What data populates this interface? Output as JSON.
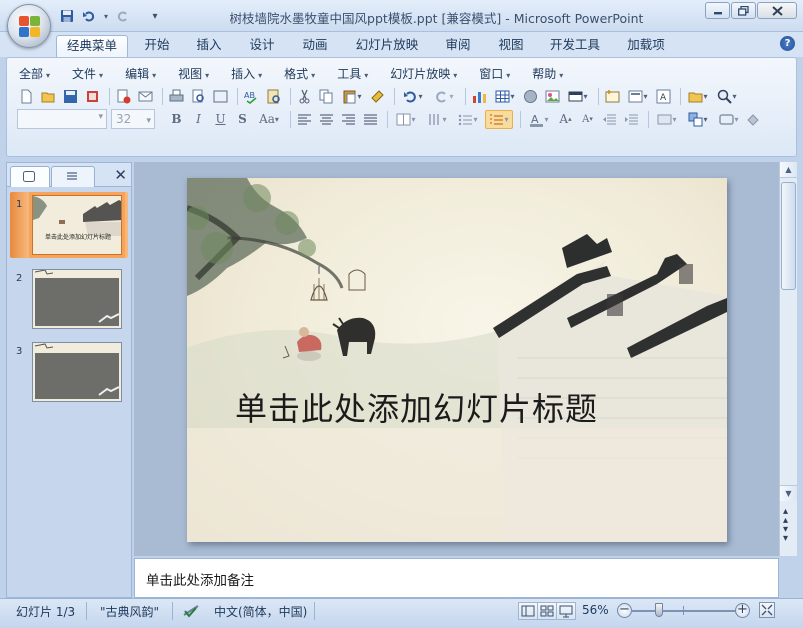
{
  "window": {
    "title": "树枝墙院水墨牧童中国风ppt模板.ppt [兼容模式] - Microsoft PowerPoint",
    "minimize_icon": "minimize-icon",
    "maximize_icon": "restore-icon",
    "close_icon": "close-icon"
  },
  "qat": {
    "save_icon": "save-icon",
    "undo_icon": "undo-icon",
    "redo_icon": "redo-icon",
    "customize_icon": "customize-qat-icon"
  },
  "tabs": [
    {
      "label": "经典菜单",
      "active": true
    },
    {
      "label": "开始"
    },
    {
      "label": "插入"
    },
    {
      "label": "设计"
    },
    {
      "label": "动画"
    },
    {
      "label": "幻灯片放映"
    },
    {
      "label": "审阅"
    },
    {
      "label": "视图"
    },
    {
      "label": "开发工具"
    },
    {
      "label": "加载项"
    }
  ],
  "menus": [
    "全部",
    "文件",
    "编辑",
    "视图",
    "插入",
    "格式",
    "工具",
    "幻灯片放映",
    "窗口",
    "帮助"
  ],
  "font": {
    "name": "",
    "size": "32"
  },
  "slides_panel": {
    "items": [
      {
        "number": "1",
        "thumb_title": "单击此处添加幻灯片标题"
      },
      {
        "number": "2"
      },
      {
        "number": "3"
      }
    ]
  },
  "slide": {
    "title_placeholder": "单击此处添加幻灯片标题"
  },
  "notes": {
    "placeholder": "单击此处添加备注"
  },
  "status": {
    "slide_info": "幻灯片 1/3",
    "theme": "\"古典风韵\"",
    "language": "中文(简体，中国)",
    "zoom": "56%",
    "zoom_fraction": 0.56
  },
  "colors": {
    "accent_selection": "#f6a45c",
    "ribbon_bg": "#e6eef9",
    "slide_paper": "#f0ebd8"
  }
}
